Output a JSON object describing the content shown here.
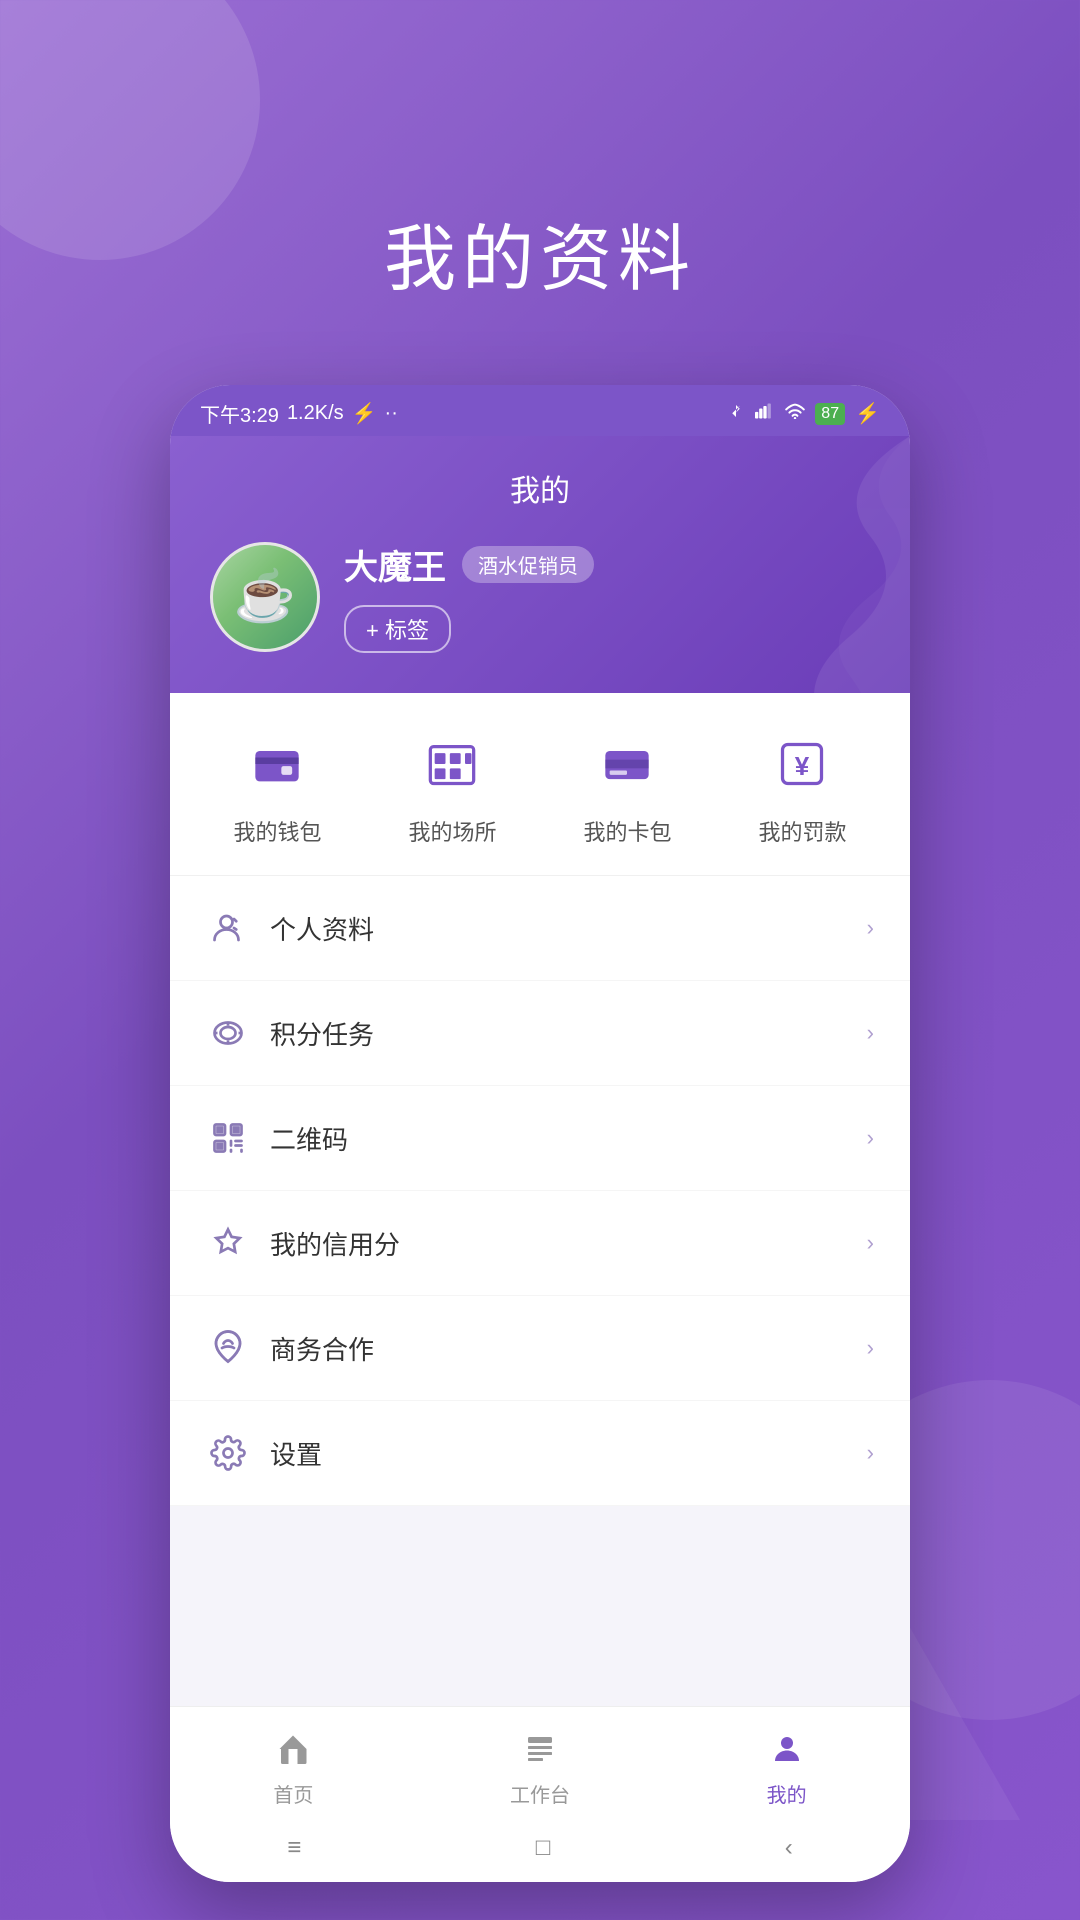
{
  "page": {
    "title": "我的资料",
    "background_color": "#8855cc"
  },
  "status_bar": {
    "time": "下午3:29",
    "network": "1.2K/s",
    "battery": "87"
  },
  "profile_header": {
    "section_title": "我的",
    "user_name": "大魔王",
    "role_badge": "酒水促销员",
    "tag_button": "+ 标签"
  },
  "quick_actions": [
    {
      "id": "wallet",
      "label": "我的钱包",
      "icon": "wallet-icon"
    },
    {
      "id": "venue",
      "label": "我的场所",
      "icon": "venue-icon"
    },
    {
      "id": "card",
      "label": "我的卡包",
      "icon": "card-icon"
    },
    {
      "id": "fine",
      "label": "我的罚款",
      "icon": "fine-icon"
    }
  ],
  "menu_items": [
    {
      "id": "profile",
      "label": "个人资料",
      "icon": "person-icon"
    },
    {
      "id": "points",
      "label": "积分任务",
      "icon": "points-icon"
    },
    {
      "id": "qrcode",
      "label": "二维码",
      "icon": "qrcode-icon"
    },
    {
      "id": "credit",
      "label": "我的信用分",
      "icon": "credit-icon"
    },
    {
      "id": "business",
      "label": "商务合作",
      "icon": "business-icon"
    },
    {
      "id": "settings",
      "label": "设置",
      "icon": "settings-icon"
    }
  ],
  "bottom_nav": [
    {
      "id": "home",
      "label": "首页",
      "icon": "home-icon",
      "active": false
    },
    {
      "id": "workbench",
      "label": "工作台",
      "icon": "workbench-icon",
      "active": false
    },
    {
      "id": "mine",
      "label": "我的",
      "icon": "mine-icon",
      "active": true
    }
  ],
  "system_nav": {
    "menu": "≡",
    "home": "□",
    "back": "‹"
  }
}
